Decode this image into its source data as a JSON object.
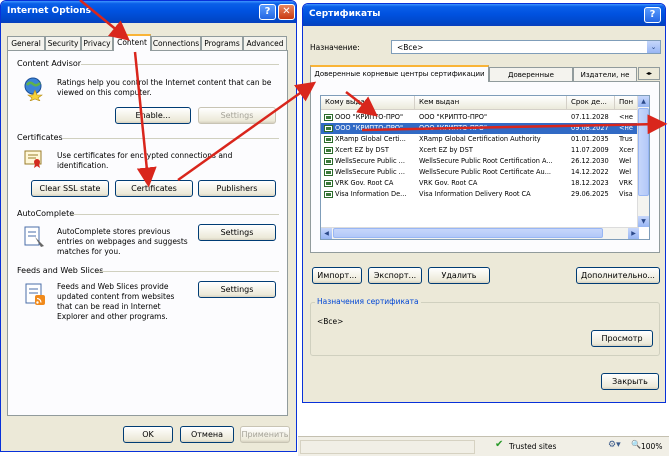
{
  "ie": {
    "title": "Internet Options",
    "help": "?",
    "close": "✕",
    "tabs": [
      "General",
      "Security",
      "Privacy",
      "Content",
      "Connections",
      "Programs",
      "Advanced"
    ],
    "content_advisor": {
      "heading": "Content Advisor",
      "text": "Ratings help you control the Internet content that can be viewed on this computer.",
      "enable": "Enable...",
      "settings": "Settings"
    },
    "certificates": {
      "heading": "Certificates",
      "text": "Use certificates for encrypted connections and identification.",
      "clear_ssl": "Clear SSL state",
      "certificates": "Certificates",
      "publishers": "Publishers"
    },
    "autocomplete": {
      "heading": "AutoComplete",
      "text": "AutoComplete stores previous entries on webpages and suggests matches for you.",
      "settings": "Settings"
    },
    "feeds": {
      "heading": "Feeds and Web Slices",
      "text": "Feeds and Web Slices provide updated content from websites that can be read in Internet Explorer and other programs.",
      "settings": "Settings"
    },
    "ok": "OK",
    "cancel": "Отмена",
    "apply": "Применить"
  },
  "certs": {
    "title": "Сертификаты",
    "help": "?",
    "purpose_label": "Назначение:",
    "purpose_value": "<Все>",
    "tabs": [
      "Доверенные корневые центры сертификации",
      "Доверенные издатели",
      "Издатели, не"
    ],
    "columns": [
      "Кому выдан",
      "Кем выдан",
      "Срок де...",
      "Пон"
    ],
    "rows": [
      [
        "ООО \"КРИПТО-ПРО\"",
        "ООО \"КРИПТО-ПРО\"",
        "07.11.2028",
        "<не"
      ],
      [
        "ООО \"КРИПТО-ПРО\"",
        "ООО \"КРИПТО-ПРО\"",
        "09.08.2027",
        "<не"
      ],
      [
        "XRamp Global Certi...",
        "XRamp Global Certification Authority",
        "01.01.2035",
        "Trus"
      ],
      [
        "Xcert EZ by DST",
        "Xcert EZ by DST",
        "11.07.2009",
        "Xcer"
      ],
      [
        "WellsSecure Public ...",
        "WellsSecure Public Root Certification A...",
        "26.12.2030",
        "Wel"
      ],
      [
        "WellsSecure Public ...",
        "WellsSecure Public Root Certificate Au...",
        "14.12.2022",
        "Wel"
      ],
      [
        "VRK Gov. Root CA",
        "VRK Gov. Root CA",
        "18.12.2023",
        "VRK"
      ],
      [
        "Visa Information De...",
        "Visa Information Delivery Root CA",
        "29.06.2025",
        "Visa"
      ]
    ],
    "selected_row": 1,
    "import": "Импорт...",
    "export": "Экспорт...",
    "delete": "Удалить",
    "advanced": "Дополнительно...",
    "purposes_heading": "Назначения сертификата",
    "purposes_value": "<Все>",
    "view": "Просмотр",
    "close_btn": "Закрыть"
  },
  "statusbar": {
    "zone": "Trusted sites",
    "zoom": "100%"
  },
  "colors": {
    "accent_red": "#d9261c",
    "selection": "#316ac5",
    "xp_blue": "#0052e0"
  }
}
